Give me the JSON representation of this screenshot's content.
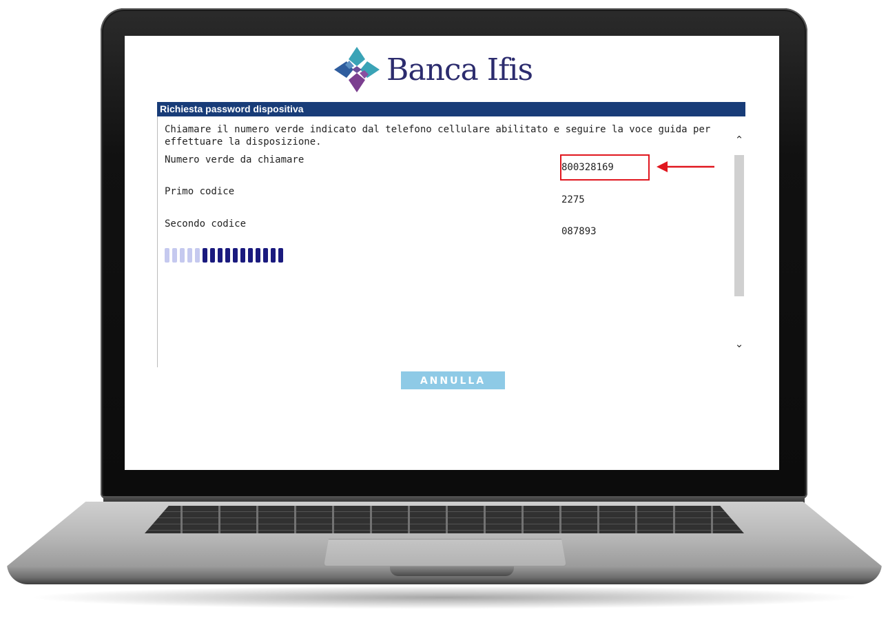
{
  "brand": {
    "name": "Banca Ifis",
    "logo_icon": "diamond-flower-logo",
    "colors": {
      "navy": "#2c2c6e",
      "teal": "#3aa3b6",
      "purple": "#7b3f8f",
      "blue": "#2f5d9e"
    }
  },
  "panel": {
    "title": "Richiesta password dispositiva",
    "intro": "Chiamare il numero verde indicato dal telefono cellulare abilitato e seguire la voce guida per effettuare la disposizione.",
    "rows": [
      {
        "label": "Numero verde da chiamare",
        "value": "800328169"
      },
      {
        "label": "Primo codice",
        "value": "2275"
      },
      {
        "label": "Secondo codice",
        "value": "087893"
      }
    ],
    "progress": {
      "total_segments": 16,
      "completed_segments": 5,
      "done_color": "#c5c9ef",
      "pending_color": "#1a1a7e"
    }
  },
  "scrollbar": {
    "up_icon": "chevron-up-icon",
    "down_icon": "chevron-down-icon"
  },
  "annotation": {
    "highlight_color": "#e0161e",
    "arrow_icon": "arrow-left-icon"
  },
  "actions": {
    "cancel_label": "ANNULLA"
  },
  "colors": {
    "header_bg": "#183c78",
    "button_bg": "#8ecae6"
  }
}
